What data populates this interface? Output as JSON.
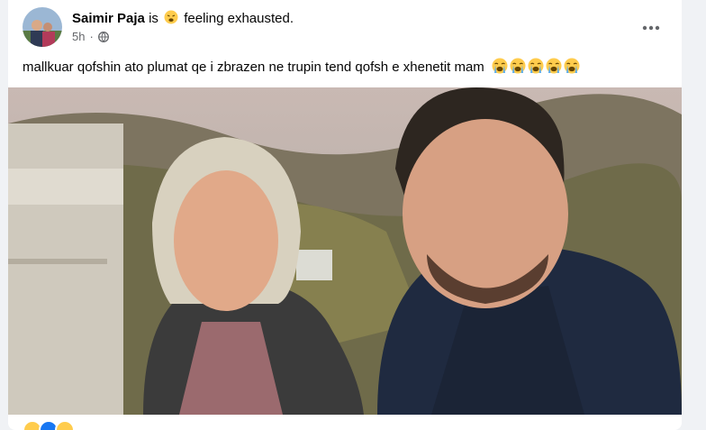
{
  "post": {
    "author": "Saimir Paja",
    "is_text": "is",
    "feeling": "feeling exhausted.",
    "timestamp": "5h",
    "privacy_icon": "globe-icon",
    "more_icon": "ellipsis-icon",
    "caption": "mallkuar qofshin ato plumat qe i zbrazen ne trupin tend qofsh e xhenetit mam",
    "caption_emoji_count": 5,
    "caption_emoji": "loudly-crying-face",
    "feeling_emoji": "tired-face"
  },
  "colors": {
    "meta": "#65676b",
    "emoji_yellow": "#ffcc4d",
    "card_bg": "#ffffff",
    "page_bg": "#f0f2f5"
  }
}
